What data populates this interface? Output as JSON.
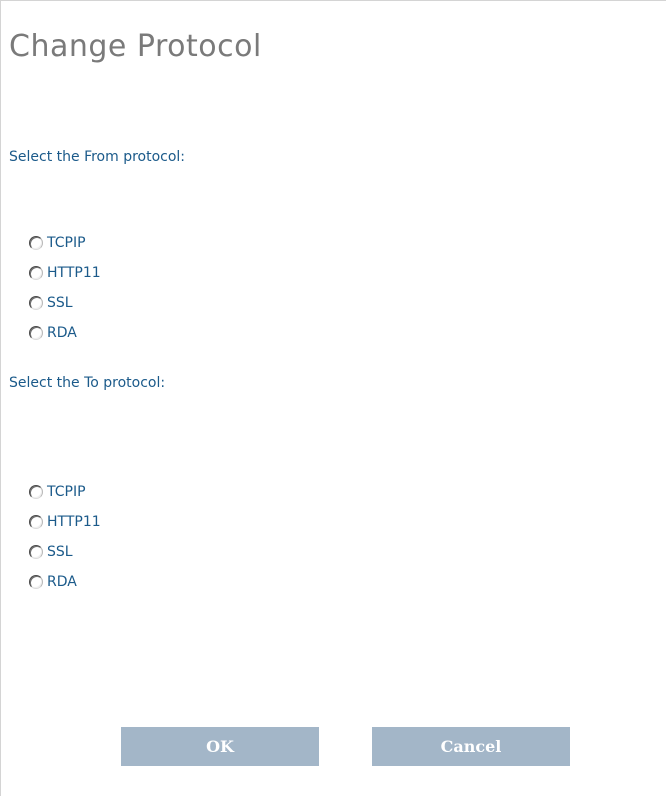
{
  "dialog": {
    "title": "Change Protocol"
  },
  "from_section": {
    "label": "Select the From protocol:",
    "options": [
      "TCPIP",
      "HTTP11",
      "SSL",
      "RDA"
    ]
  },
  "to_section": {
    "label": "Select the To protocol:",
    "options": [
      "TCPIP",
      "HTTP11",
      "SSL",
      "RDA"
    ]
  },
  "buttons": {
    "ok_label": "OK",
    "cancel_label": "Cancel"
  },
  "colors": {
    "title": "#7a7a7a",
    "text_link_blue": "#1b5a8a",
    "button_bg": "#a3b6c8",
    "button_text": "#ffffff"
  }
}
